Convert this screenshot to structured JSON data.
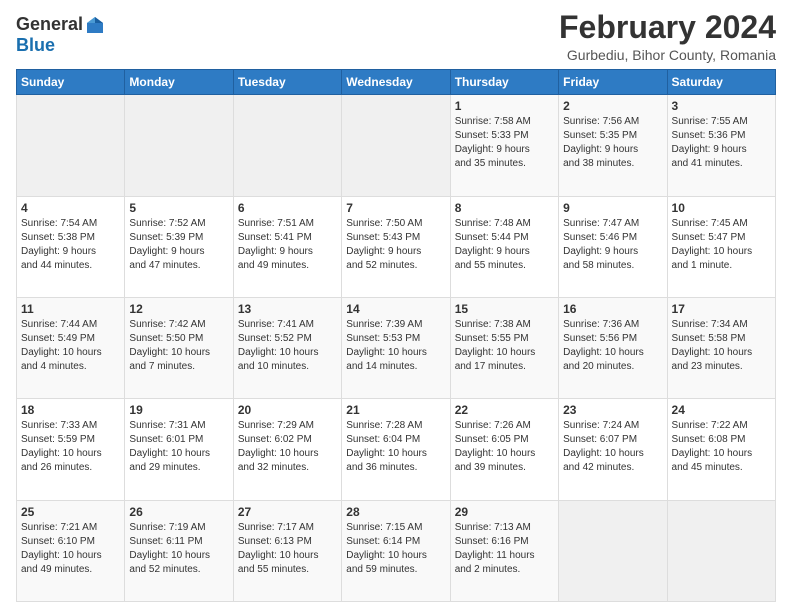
{
  "logo": {
    "general": "General",
    "blue": "Blue"
  },
  "title": "February 2024",
  "subtitle": "Gurbediu, Bihor County, Romania",
  "days_header": [
    "Sunday",
    "Monday",
    "Tuesday",
    "Wednesday",
    "Thursday",
    "Friday",
    "Saturday"
  ],
  "weeks": [
    [
      {
        "day": "",
        "info": ""
      },
      {
        "day": "",
        "info": ""
      },
      {
        "day": "",
        "info": ""
      },
      {
        "day": "",
        "info": ""
      },
      {
        "day": "1",
        "info": "Sunrise: 7:58 AM\nSunset: 5:33 PM\nDaylight: 9 hours\nand 35 minutes."
      },
      {
        "day": "2",
        "info": "Sunrise: 7:56 AM\nSunset: 5:35 PM\nDaylight: 9 hours\nand 38 minutes."
      },
      {
        "day": "3",
        "info": "Sunrise: 7:55 AM\nSunset: 5:36 PM\nDaylight: 9 hours\nand 41 minutes."
      }
    ],
    [
      {
        "day": "4",
        "info": "Sunrise: 7:54 AM\nSunset: 5:38 PM\nDaylight: 9 hours\nand 44 minutes."
      },
      {
        "day": "5",
        "info": "Sunrise: 7:52 AM\nSunset: 5:39 PM\nDaylight: 9 hours\nand 47 minutes."
      },
      {
        "day": "6",
        "info": "Sunrise: 7:51 AM\nSunset: 5:41 PM\nDaylight: 9 hours\nand 49 minutes."
      },
      {
        "day": "7",
        "info": "Sunrise: 7:50 AM\nSunset: 5:43 PM\nDaylight: 9 hours\nand 52 minutes."
      },
      {
        "day": "8",
        "info": "Sunrise: 7:48 AM\nSunset: 5:44 PM\nDaylight: 9 hours\nand 55 minutes."
      },
      {
        "day": "9",
        "info": "Sunrise: 7:47 AM\nSunset: 5:46 PM\nDaylight: 9 hours\nand 58 minutes."
      },
      {
        "day": "10",
        "info": "Sunrise: 7:45 AM\nSunset: 5:47 PM\nDaylight: 10 hours\nand 1 minute."
      }
    ],
    [
      {
        "day": "11",
        "info": "Sunrise: 7:44 AM\nSunset: 5:49 PM\nDaylight: 10 hours\nand 4 minutes."
      },
      {
        "day": "12",
        "info": "Sunrise: 7:42 AM\nSunset: 5:50 PM\nDaylight: 10 hours\nand 7 minutes."
      },
      {
        "day": "13",
        "info": "Sunrise: 7:41 AM\nSunset: 5:52 PM\nDaylight: 10 hours\nand 10 minutes."
      },
      {
        "day": "14",
        "info": "Sunrise: 7:39 AM\nSunset: 5:53 PM\nDaylight: 10 hours\nand 14 minutes."
      },
      {
        "day": "15",
        "info": "Sunrise: 7:38 AM\nSunset: 5:55 PM\nDaylight: 10 hours\nand 17 minutes."
      },
      {
        "day": "16",
        "info": "Sunrise: 7:36 AM\nSunset: 5:56 PM\nDaylight: 10 hours\nand 20 minutes."
      },
      {
        "day": "17",
        "info": "Sunrise: 7:34 AM\nSunset: 5:58 PM\nDaylight: 10 hours\nand 23 minutes."
      }
    ],
    [
      {
        "day": "18",
        "info": "Sunrise: 7:33 AM\nSunset: 5:59 PM\nDaylight: 10 hours\nand 26 minutes."
      },
      {
        "day": "19",
        "info": "Sunrise: 7:31 AM\nSunset: 6:01 PM\nDaylight: 10 hours\nand 29 minutes."
      },
      {
        "day": "20",
        "info": "Sunrise: 7:29 AM\nSunset: 6:02 PM\nDaylight: 10 hours\nand 32 minutes."
      },
      {
        "day": "21",
        "info": "Sunrise: 7:28 AM\nSunset: 6:04 PM\nDaylight: 10 hours\nand 36 minutes."
      },
      {
        "day": "22",
        "info": "Sunrise: 7:26 AM\nSunset: 6:05 PM\nDaylight: 10 hours\nand 39 minutes."
      },
      {
        "day": "23",
        "info": "Sunrise: 7:24 AM\nSunset: 6:07 PM\nDaylight: 10 hours\nand 42 minutes."
      },
      {
        "day": "24",
        "info": "Sunrise: 7:22 AM\nSunset: 6:08 PM\nDaylight: 10 hours\nand 45 minutes."
      }
    ],
    [
      {
        "day": "25",
        "info": "Sunrise: 7:21 AM\nSunset: 6:10 PM\nDaylight: 10 hours\nand 49 minutes."
      },
      {
        "day": "26",
        "info": "Sunrise: 7:19 AM\nSunset: 6:11 PM\nDaylight: 10 hours\nand 52 minutes."
      },
      {
        "day": "27",
        "info": "Sunrise: 7:17 AM\nSunset: 6:13 PM\nDaylight: 10 hours\nand 55 minutes."
      },
      {
        "day": "28",
        "info": "Sunrise: 7:15 AM\nSunset: 6:14 PM\nDaylight: 10 hours\nand 59 minutes."
      },
      {
        "day": "29",
        "info": "Sunrise: 7:13 AM\nSunset: 6:16 PM\nDaylight: 11 hours\nand 2 minutes."
      },
      {
        "day": "",
        "info": ""
      },
      {
        "day": "",
        "info": ""
      }
    ]
  ]
}
